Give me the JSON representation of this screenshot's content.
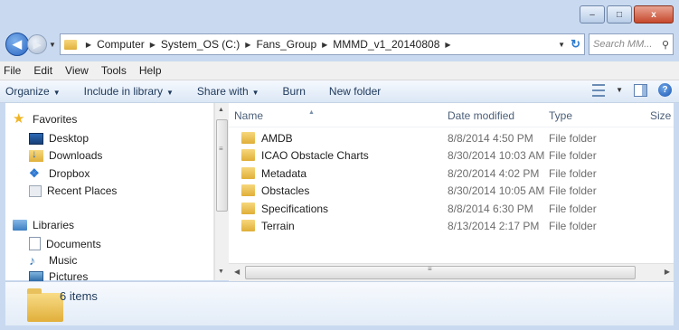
{
  "window": {
    "controls": {
      "minimize": "–",
      "maximize": "□",
      "close": "x"
    }
  },
  "address": {
    "crumbs": [
      "Computer",
      "System_OS (C:)",
      "Fans_Group",
      "MMMD_v1_20140808"
    ],
    "search_placeholder": "Search MM..."
  },
  "menu": [
    "File",
    "Edit",
    "View",
    "Tools",
    "Help"
  ],
  "commands": {
    "organize": "Organize",
    "include_in_library": "Include in library",
    "share_with": "Share with",
    "burn": "Burn",
    "new_folder": "New folder"
  },
  "nav": {
    "favorites_header": "Favorites",
    "favorites": [
      "Desktop",
      "Downloads",
      "Dropbox",
      "Recent Places"
    ],
    "libraries_header": "Libraries",
    "libraries": [
      "Documents",
      "Music",
      "Pictures"
    ]
  },
  "columns": {
    "name": "Name",
    "date": "Date modified",
    "type": "Type",
    "size": "Size"
  },
  "files": [
    {
      "name": "AMDB",
      "date": "8/8/2014 4:50 PM",
      "type": "File folder"
    },
    {
      "name": "ICAO Obstacle Charts",
      "date": "8/30/2014 10:03 AM",
      "type": "File folder"
    },
    {
      "name": "Metadata",
      "date": "8/20/2014 4:02 PM",
      "type": "File folder"
    },
    {
      "name": "Obstacles",
      "date": "8/30/2014 10:05 AM",
      "type": "File folder"
    },
    {
      "name": "Specifications",
      "date": "8/8/2014 6:30 PM",
      "type": "File folder"
    },
    {
      "name": "Terrain",
      "date": "8/13/2014 2:17 PM",
      "type": "File folder"
    }
  ],
  "details": {
    "count": "6 items"
  },
  "colors": {
    "accent": "#1e395b",
    "chrome": "#c9daf0",
    "folder": "#e0b13c"
  }
}
